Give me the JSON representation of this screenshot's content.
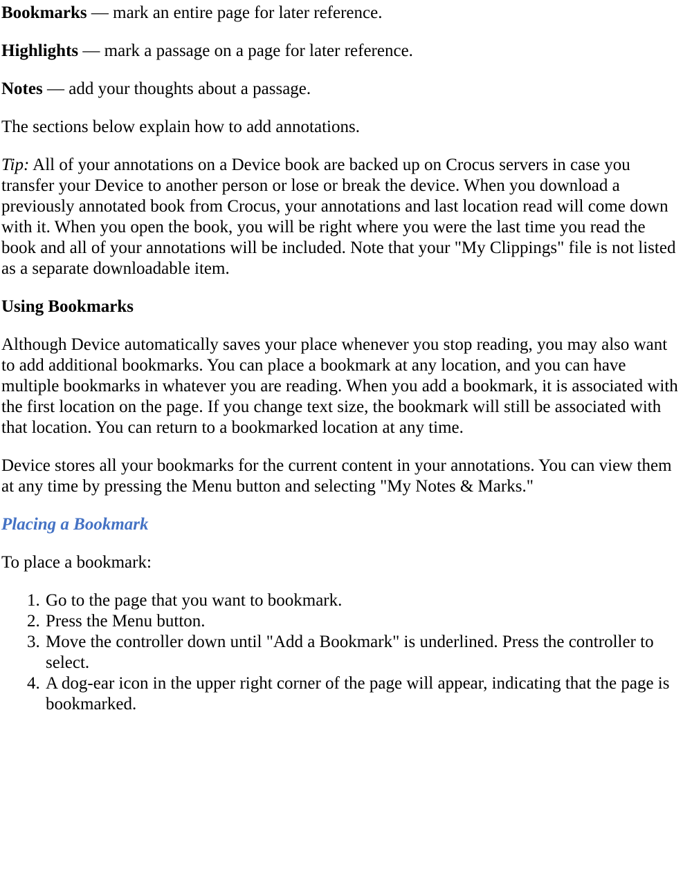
{
  "defs": {
    "bookmarks_term": "Bookmarks",
    "bookmarks_desc": " — mark an entire page for later reference.",
    "highlights_term": "Highlights",
    "highlights_desc": " — mark a passage on a page for later reference.",
    "notes_term": "Notes",
    "notes_desc": " — add your thoughts about a passage."
  },
  "intro": "The sections below explain how to add annotations.",
  "tip_label": "Tip:",
  "tip_body": " All of your annotations on a Device book are backed up on Crocus servers in case you transfer your Device to another person or lose or break the device. When you download a previously annotated book from Crocus, your annotations and last location read will come down with it. When you open the book, you will be right where you were the last time you read the book and all of your annotations will be included. Note that your \"My Clippings\" file is not listed as a separate downloadable item.",
  "section1": {
    "heading": "Using Bookmarks",
    "p1": "Although Device automatically saves your place whenever you stop reading, you may also want to add additional bookmarks. You can place a bookmark at any location, and you can have multiple bookmarks in whatever you are reading. When you add a bookmark, it is associated with the first location on the page. If you change text size, the bookmark will still be associated with that location. You can return to a bookmarked location at any time.",
    "p2": "Device stores all your bookmarks for the current content in your annotations. You can view them at any time by pressing the Menu button and selecting \"My Notes & Marks.\""
  },
  "section2": {
    "heading": "Placing a Bookmark",
    "intro": "To place a bookmark:",
    "steps": {
      "s1": "Go to the page that you want to bookmark.",
      "s2": "Press the Menu button.",
      "s3": "Move the controller down until \"Add a Bookmark\" is underlined. Press the controller to select.",
      "s4": "A dog-ear icon in the upper right corner of the page will appear, indicating that the page is bookmarked."
    }
  }
}
